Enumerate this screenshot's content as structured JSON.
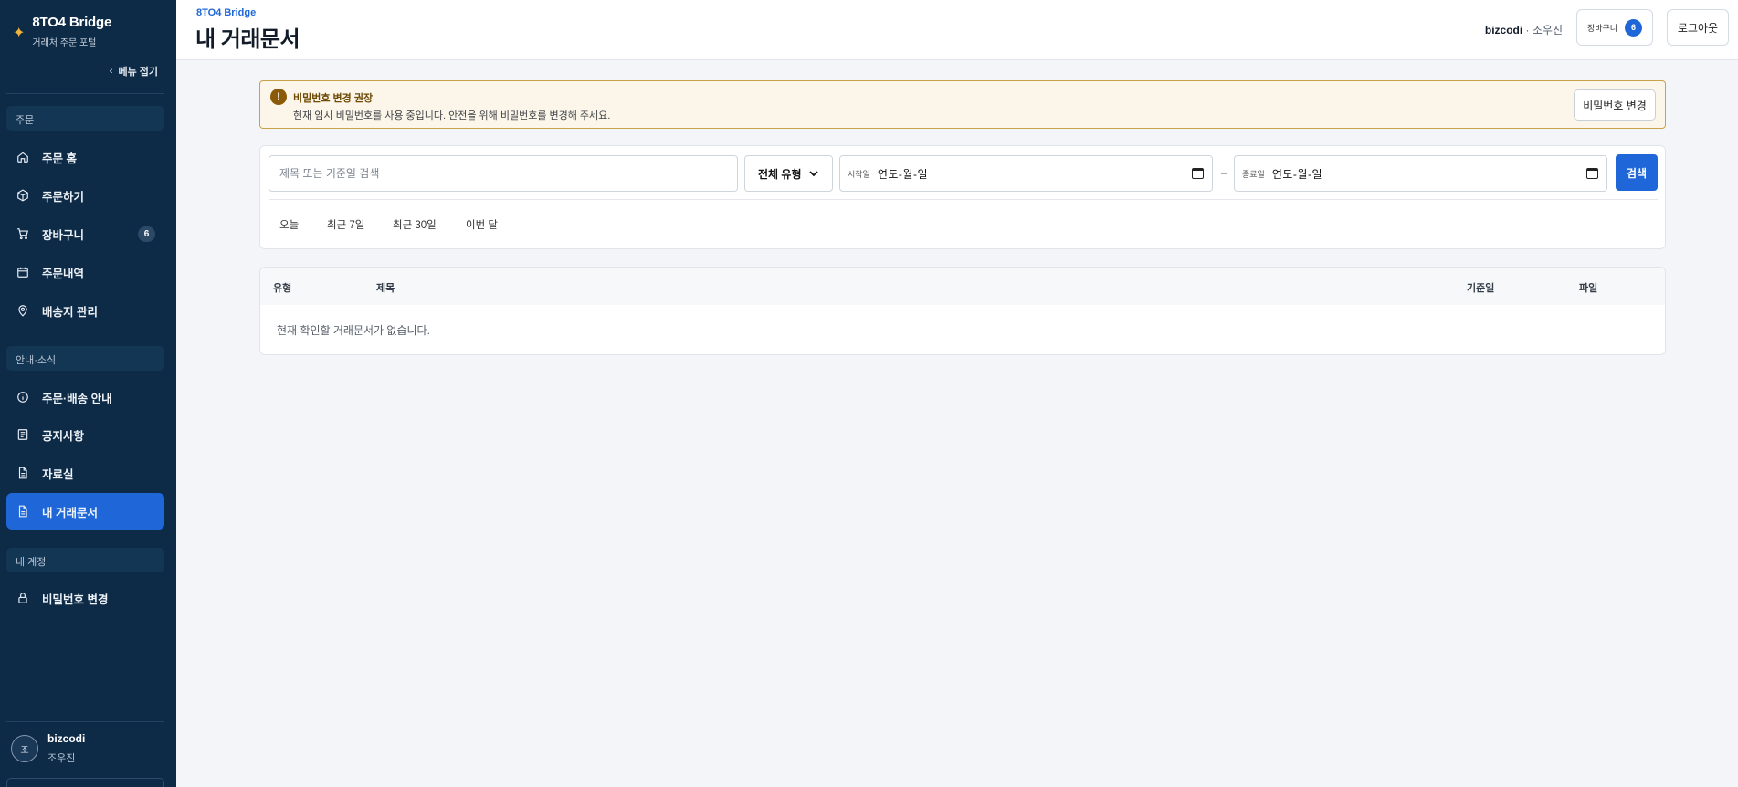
{
  "app": {
    "name": "8TO4 Bridge",
    "subtitle": "거래처 주문 포털"
  },
  "sidebar": {
    "collapse_label": "메뉴 접기",
    "sections": [
      {
        "label": "주문"
      },
      {
        "label": "안내·소식"
      },
      {
        "label": "내 계정"
      }
    ],
    "items": [
      {
        "label": "주문 홈",
        "icon": "home-icon"
      },
      {
        "label": "주문하기",
        "icon": "box-icon"
      },
      {
        "label": "장바구니",
        "icon": "cart-icon",
        "badge": "6"
      },
      {
        "label": "주문내역",
        "icon": "calendar-icon"
      },
      {
        "label": "배송지 관리",
        "icon": "location-icon"
      },
      {
        "label": "주문·배송 안내",
        "icon": "info-icon"
      },
      {
        "label": "공지사항",
        "icon": "notice-icon"
      },
      {
        "label": "자료실",
        "icon": "document-icon"
      },
      {
        "label": "내 거래문서",
        "icon": "document-icon",
        "active": true
      },
      {
        "label": "비밀번호 변경",
        "icon": "lock-icon"
      }
    ],
    "user": {
      "initial": "조",
      "company": "bizcodi",
      "name": "조우진"
    }
  },
  "header": {
    "breadcrumb": "8TO4 Bridge",
    "title": "내 거래문서",
    "account_company": "bizcodi",
    "account_name": "· 조우진",
    "cart_label": "장바구니",
    "cart_count": "6",
    "logout_label": "로그아웃"
  },
  "alert": {
    "title": "비밀번호 변경 권장",
    "message": "현재 임시 비밀번호를 사용 중입니다. 안전을 위해 비밀번호를 변경해 주세요.",
    "button_label": "비밀번호 변경",
    "icon_glyph": "!"
  },
  "filter": {
    "search_placeholder": "제목 또는 기준일 검색",
    "type_value": "전체 유형",
    "start_label": "시작일",
    "start_value": "연도-월-일",
    "end_label": "종료일",
    "end_value": "연도-월-일",
    "range_separator": "–",
    "search_button": "검색",
    "quick_ranges": [
      "오늘",
      "최근 7일",
      "최근 30일",
      "이번 달"
    ]
  },
  "table": {
    "columns": [
      "유형",
      "제목",
      "기준일",
      "파일"
    ],
    "empty_message": "현재 확인할 거래문서가 없습니다."
  },
  "colors": {
    "sidebar_bg": "#0d2a47",
    "accent": "#1f67d8",
    "alert_bg": "#fbf6e9",
    "alert_border": "#c8a24a",
    "brand_star": "#f0b43a"
  }
}
